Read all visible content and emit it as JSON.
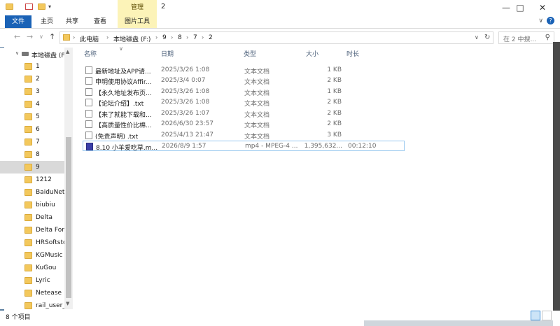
{
  "titlebar": {
    "title": "2",
    "context_tab": "管理",
    "buttons": [
      "minimize-icon",
      "maximize-icon",
      "close-icon"
    ]
  },
  "ribbon": {
    "tabs": [
      "文件",
      "主页",
      "共享",
      "查看",
      "图片工具"
    ]
  },
  "address": {
    "crumbs": [
      "此电脑",
      "本地磁盘 (F:)",
      "9",
      "8",
      "7",
      "2"
    ],
    "search_placeholder": "在 2 中搜..."
  },
  "nav": {
    "drive_label": "本地磁盘 (F",
    "folders": [
      "1",
      "2",
      "3",
      "4",
      "5",
      "6",
      "7",
      "8",
      "9",
      "1212",
      "BaiduNet",
      "biubiu",
      "Delta",
      "Delta Forc",
      "HRSoftsto",
      "KGMusic",
      "KuGou",
      "Lyric",
      "Netease",
      "rail_user_c"
    ],
    "selected": "9"
  },
  "columns": {
    "name": "名称",
    "date": "日期",
    "type": "类型",
    "size": "大小",
    "duration": "时长"
  },
  "files": [
    {
      "name": "最新地址及APP请...",
      "date": "2025/3/26 1:08",
      "type": "文本文档",
      "size": "1 KB",
      "duration": "",
      "icon": "text-file-icon"
    },
    {
      "name": "申明使用协议Affir...",
      "date": "2025/3/4 0:07",
      "type": "文本文档",
      "size": "2 KB",
      "duration": "",
      "icon": "text-file-icon"
    },
    {
      "name": "【永久地址发布页...",
      "date": "2025/3/26 1:08",
      "type": "文本文档",
      "size": "1 KB",
      "duration": "",
      "icon": "text-file-icon"
    },
    {
      "name": "【论坛介绍】.txt",
      "date": "2025/3/26 1:08",
      "type": "文本文档",
      "size": "2 KB",
      "duration": "",
      "icon": "text-file-icon"
    },
    {
      "name": "【来了就能下载和...",
      "date": "2025/3/26 1:07",
      "type": "文本文档",
      "size": "2 KB",
      "duration": "",
      "icon": "text-file-icon"
    },
    {
      "name": "【高质量性价比棉...",
      "date": "2026/6/30 23:57",
      "type": "文本文档",
      "size": "2 KB",
      "duration": "",
      "icon": "text-file-icon"
    },
    {
      "name": "(免责声明) .txt",
      "date": "2025/4/13 21:47",
      "type": "文本文档",
      "size": "3 KB",
      "duration": "",
      "icon": "text-file-icon"
    },
    {
      "name": "8.10 小羊爱吃草.m...",
      "date": "2026/8/9 1:57",
      "type": "mp4 - MPEG-4 ...",
      "size": "1,395,632...",
      "duration": "00:12:10",
      "icon": "video-file-icon"
    }
  ],
  "status": {
    "count": "8 个项目"
  }
}
